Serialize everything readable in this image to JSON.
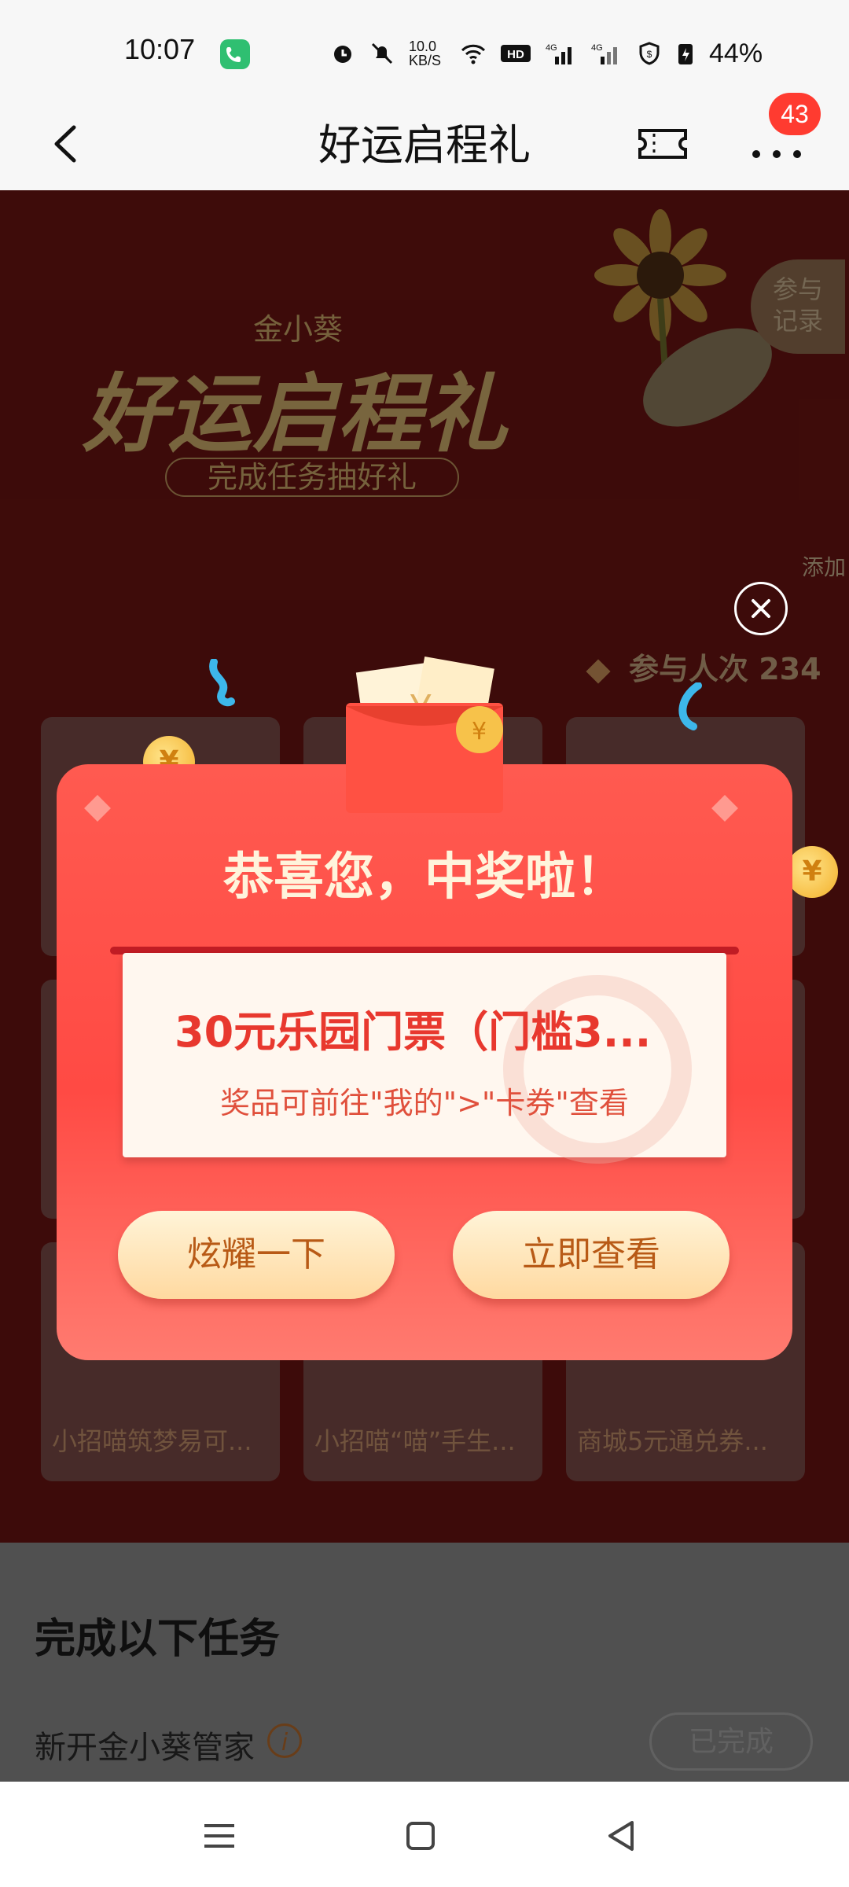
{
  "status_bar": {
    "time": "10:07",
    "network_speed": "10.0 KB/S",
    "battery_percent": "44%",
    "icons": [
      "call-icon",
      "alarm-icon",
      "mute-icon",
      "wifi-icon",
      "hd-icon",
      "signal-4g-icon",
      "signal-4g-icon",
      "shield-icon",
      "battery-icon"
    ]
  },
  "header": {
    "title": "好运启程礼",
    "badge_count": "43"
  },
  "banner": {
    "brand": "金小葵",
    "title": "好运启程礼",
    "subtitle": "完成任务抽好礼",
    "record_button": "参与\n记录",
    "add_button": "添加",
    "participants_label": "参与人次 234"
  },
  "prize_cards": [
    {
      "label": ""
    },
    {
      "label": ""
    },
    {
      "label": ""
    },
    {
      "label": ""
    },
    {
      "label": ""
    },
    {
      "label": ""
    },
    {
      "label": "小招喵筑梦易可..."
    },
    {
      "label": "小招喵“喵”手生..."
    },
    {
      "label": "商城5元通兑券..."
    }
  ],
  "modal": {
    "title": "恭喜您，中奖啦！",
    "prize_name": "30元乐园门票（门槛3...",
    "prize_hint": "奖品可前往\"我的\">\"卡券\"查看",
    "share_button": "炫耀一下",
    "view_button": "立即查看"
  },
  "tasks": {
    "section_title": "完成以下任务",
    "items": [
      {
        "name": "新开金小葵管家",
        "status": "已完成"
      }
    ]
  },
  "colors": {
    "banner_bg": "#6a1412",
    "modal_red": "#ff4a44",
    "gold_text": "#caa868",
    "button_text": "#b85a16",
    "badge_red": "#ff3b30"
  }
}
